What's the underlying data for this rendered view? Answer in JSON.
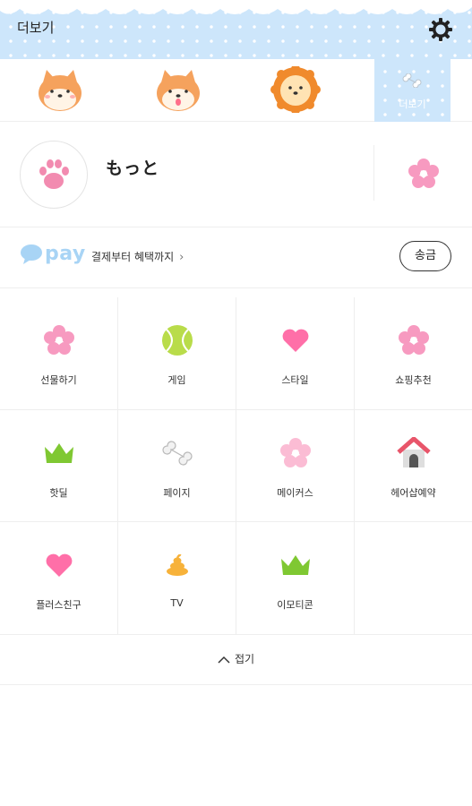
{
  "header": {
    "title": "더보기",
    "settings_icon": "gear-icon"
  },
  "profiles": [
    {
      "icon": "shiba-dog-face-icon"
    },
    {
      "icon": "shiba-dog-tongue-icon"
    },
    {
      "icon": "lion-face-icon"
    }
  ],
  "more_tab": {
    "label": "더보기",
    "icon": "bone-icon"
  },
  "user": {
    "name": "もっと",
    "avatar_icon": "paw-icon",
    "side_icon": "pink-flower-icon"
  },
  "pay": {
    "logo_text": "pay",
    "description": "결제부터 혜택까지",
    "chevron": "›",
    "transfer_label": "송금"
  },
  "grid": [
    {
      "label": "선물하기",
      "icon": "pink-flower-icon"
    },
    {
      "label": "게임",
      "icon": "tennis-ball-icon"
    },
    {
      "label": "스타일",
      "icon": "heart-icon"
    },
    {
      "label": "쇼핑추천",
      "icon": "pink-flower-icon"
    },
    {
      "label": "핫딜",
      "icon": "crown-icon"
    },
    {
      "label": "페이지",
      "icon": "bone-icon"
    },
    {
      "label": "메이커스",
      "icon": "light-pink-flower-icon"
    },
    {
      "label": "헤어샵예약",
      "icon": "dog-house-icon"
    },
    {
      "label": "플러스친구",
      "icon": "heart-icon"
    },
    {
      "label": "TV",
      "icon": "poop-icon"
    },
    {
      "label": "이모티콘",
      "icon": "crown-icon"
    }
  ],
  "collapse": {
    "label": "접기",
    "icon": "chevron-up-icon"
  },
  "colors": {
    "header_bg": "#cde6fb",
    "pay_blue": "#a8d4f5",
    "flower_pink": "#f79ac0",
    "crown_green": "#7fc832",
    "ball_green": "#b9dc4a"
  }
}
